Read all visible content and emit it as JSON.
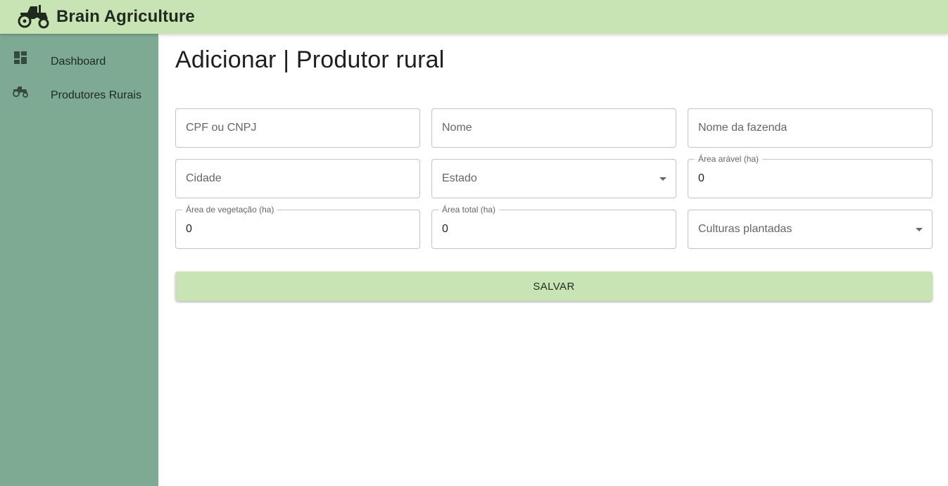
{
  "app": {
    "title": "Brain Agriculture",
    "logo_icon": "tractor-icon"
  },
  "sidebar": {
    "items": [
      {
        "label": "Dashboard",
        "icon": "dashboard-icon"
      },
      {
        "label": "Produtores Rurais",
        "icon": "tractor-icon"
      }
    ]
  },
  "page": {
    "title": "Adicionar | Produtor rural"
  },
  "form": {
    "cpf_cnpj": {
      "placeholder": "CPF ou CNPJ"
    },
    "nome": {
      "placeholder": "Nome"
    },
    "nome_fazenda": {
      "placeholder": "Nome da fazenda"
    },
    "cidade": {
      "placeholder": "Cidade"
    },
    "estado": {
      "placeholder": "Estado"
    },
    "area_aravel": {
      "label": "Área arável (ha)",
      "value": "0"
    },
    "area_vegetacao": {
      "label": "Área de vegetação (ha)",
      "value": "0"
    },
    "area_total": {
      "label": "Área total (ha)",
      "value": "0"
    },
    "culturas": {
      "placeholder": "Culturas plantadas"
    },
    "save_label": "SALVAR"
  },
  "colors": {
    "appbar": "#c8e4b4",
    "sidebar": "#7eaa93",
    "button": "#c8e4b4"
  }
}
